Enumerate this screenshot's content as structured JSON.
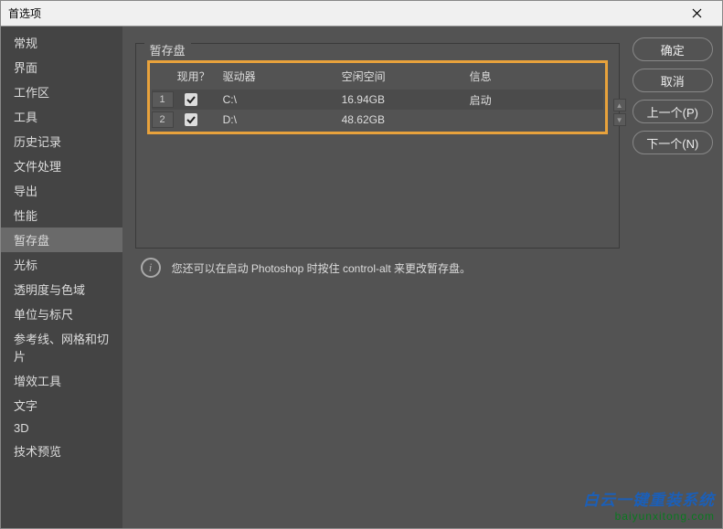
{
  "titlebar": {
    "title": "首选项"
  },
  "sidebar": {
    "items": [
      {
        "label": "常规"
      },
      {
        "label": "界面"
      },
      {
        "label": "工作区"
      },
      {
        "label": "工具"
      },
      {
        "label": "历史记录"
      },
      {
        "label": "文件处理"
      },
      {
        "label": "导出"
      },
      {
        "label": "性能"
      },
      {
        "label": "暂存盘",
        "active": true
      },
      {
        "label": "光标"
      },
      {
        "label": "透明度与色域"
      },
      {
        "label": "单位与标尺"
      },
      {
        "label": "参考线、网格和切片"
      },
      {
        "label": "增效工具"
      },
      {
        "label": "文字"
      },
      {
        "label": "3D"
      },
      {
        "label": "技术预览"
      }
    ]
  },
  "panel": {
    "title": "暂存盘",
    "headers": {
      "active": "现用？",
      "drive": "驱动器",
      "space": "空闲空间",
      "info": "信息"
    },
    "rows": [
      {
        "num": "1",
        "checked": true,
        "drive": "C:\\",
        "space": "16.94GB",
        "info": "启动"
      },
      {
        "num": "2",
        "checked": true,
        "drive": "D:\\",
        "space": "48.62GB",
        "info": ""
      }
    ],
    "hint": "您还可以在启动 Photoshop 时按住 control-alt 来更改暂存盘。"
  },
  "buttons": {
    "ok": "确定",
    "cancel": "取消",
    "prev": "上一个(P)",
    "next": "下一个(N)"
  },
  "watermark": {
    "line1": "白云一键重装系统",
    "line2": "baiyunxitong.com"
  }
}
